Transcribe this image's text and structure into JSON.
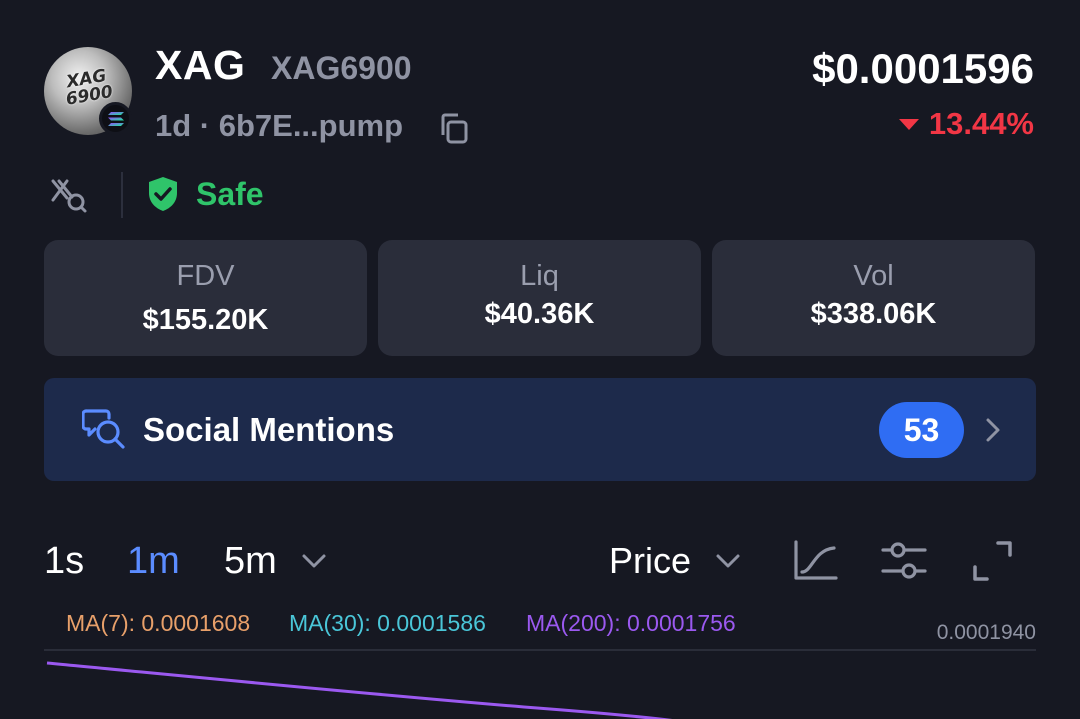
{
  "token": {
    "name": "XAG",
    "ticker": "XAG6900",
    "meta": "1d · 6b7E...pump",
    "logo_text": "XAG 6900",
    "chain_icon": "solana-icon",
    "price": "$0.0001596",
    "change": "13.44%",
    "change_direction": "down",
    "change_color": "#f23645"
  },
  "security": {
    "safe_label": "Safe",
    "safe_color": "#2fc46a"
  },
  "stats": [
    {
      "label": "FDV",
      "value": "$155.20K"
    },
    {
      "label": "Liq",
      "value": "$40.36K"
    },
    {
      "label": "Vol",
      "value": "$338.06K"
    }
  ],
  "social": {
    "label": "Social Mentions",
    "count": "53"
  },
  "toolbar": {
    "timeframes": [
      "1s",
      "1m",
      "5m"
    ],
    "active_timeframe": "1m",
    "price_mode": "Price",
    "accent": "#5b8cff",
    "icons": [
      "line-chart-icon",
      "indicator-settings-icon",
      "fullscreen-icon"
    ]
  },
  "chart": {
    "ma7": "MA(7): 0.0001608",
    "ma30": "MA(30): 0.0001586",
    "ma200": "MA(200): 0.0001756",
    "ma7_color": "#e8a06a",
    "ma30_color": "#4ac6d8",
    "ma200_color": "#9b59f0",
    "axis_top": "0.0001940"
  }
}
